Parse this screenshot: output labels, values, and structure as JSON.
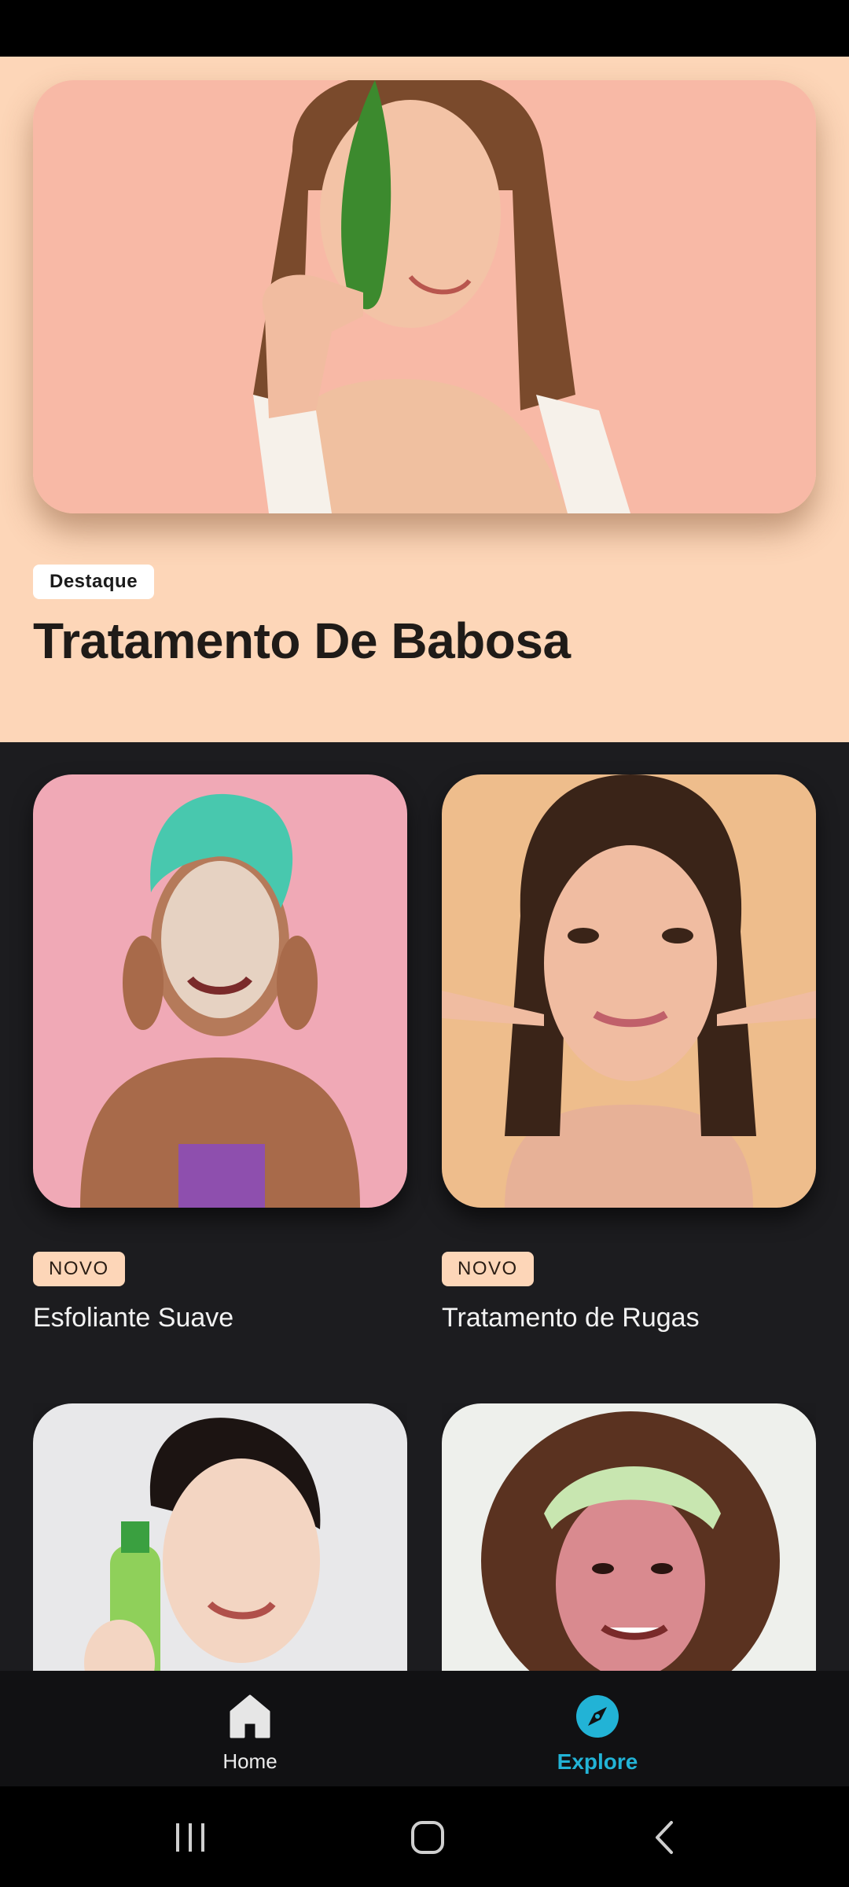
{
  "hero": {
    "badge": "Destaque",
    "title": "Tratamento De Babosa",
    "image_icon": "aloe-woman-photo"
  },
  "cards": [
    {
      "badge": "NOVO",
      "title": "Esfoliante Suave",
      "image_icon": "face-scrub-towel-photo"
    },
    {
      "badge": "NOVO",
      "title": "Tratamento de Rugas",
      "image_icon": "woman-pointing-face-photo"
    },
    {
      "image_icon": "woman-holding-bottle-photo"
    },
    {
      "image_icon": "curly-woman-mask-photo"
    }
  ],
  "bottom_nav": {
    "items": [
      {
        "label": "Home",
        "icon": "home-icon",
        "active": false
      },
      {
        "label": "Explore",
        "icon": "compass-icon",
        "active": true
      }
    ],
    "active_color": "#22b3d6"
  },
  "system_nav": {
    "icons": [
      "recent-apps-icon",
      "home-circle-icon",
      "back-icon"
    ]
  },
  "colors": {
    "hero_background": "#fdd6b8",
    "page_background": "#1c1c1f",
    "badge_background": "#fdd6b8"
  }
}
